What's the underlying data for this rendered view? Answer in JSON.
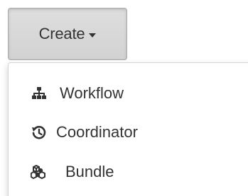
{
  "create_button": {
    "label": "Create",
    "caret_icon": "caret-down-icon"
  },
  "menu": {
    "items": [
      {
        "label": "Workflow",
        "icon": "sitemap-icon"
      },
      {
        "label": "Coordinator",
        "icon": "history-icon"
      },
      {
        "label": "Bundle",
        "icon": "cubes-icon"
      }
    ]
  },
  "colors": {
    "text": "#333333",
    "button_bg": "#d8d8d8",
    "button_border": "#a9a9a9",
    "menu_border": "#d4d4d4"
  }
}
